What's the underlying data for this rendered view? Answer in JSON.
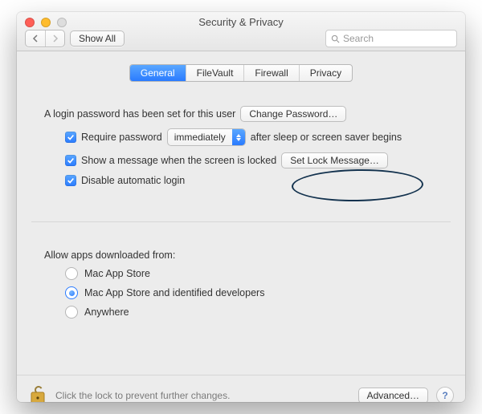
{
  "window": {
    "title": "Security & Privacy"
  },
  "toolbar": {
    "show_all": "Show All",
    "search_placeholder": "Search"
  },
  "tabs": [
    {
      "label": "General",
      "active": true
    },
    {
      "label": "FileVault",
      "active": false
    },
    {
      "label": "Firewall",
      "active": false
    },
    {
      "label": "Privacy",
      "active": false
    }
  ],
  "password_section": {
    "status_text": "A login password has been set for this user",
    "change_btn": "Change Password…",
    "require_password": {
      "checked": true,
      "label_before": "Require password",
      "delay_value": "immediately",
      "label_after": "after sleep or screen saver begins"
    },
    "lock_message": {
      "checked": true,
      "label": "Show a message when the screen is locked",
      "btn": "Set Lock Message…"
    },
    "disable_auto_login": {
      "checked": true,
      "label": "Disable automatic login"
    }
  },
  "gatekeeper": {
    "heading": "Allow apps downloaded from:",
    "options": [
      {
        "label": "Mac App Store",
        "selected": false
      },
      {
        "label": "Mac App Store and identified developers",
        "selected": true
      },
      {
        "label": "Anywhere",
        "selected": false
      }
    ]
  },
  "footer": {
    "hint": "Click the lock to prevent further changes.",
    "advanced_btn": "Advanced…"
  }
}
